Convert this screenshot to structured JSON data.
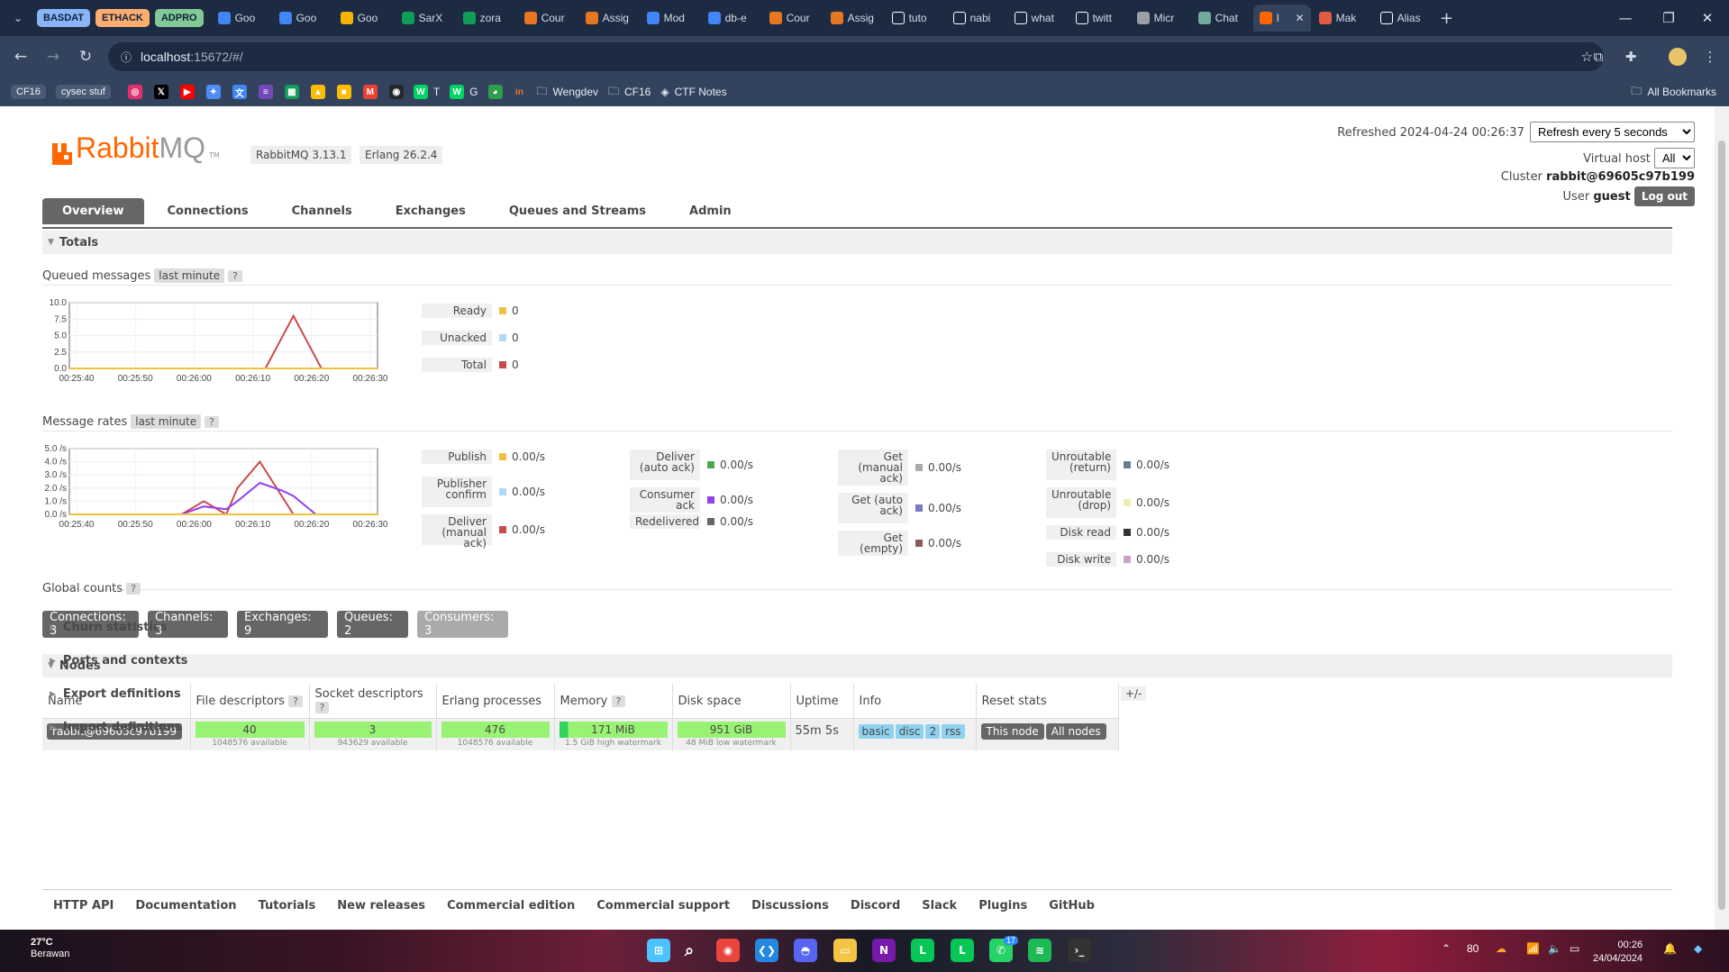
{
  "browser": {
    "tab_groups": [
      {
        "label": "BASDAT",
        "color": "#8ab4f8"
      },
      {
        "label": "ETHACK",
        "color": "#fcad70"
      },
      {
        "label": "ADPRO",
        "color": "#81c995"
      }
    ],
    "tabs": [
      {
        "label": "Goo",
        "icon": "google-icon",
        "color": "#4285f4"
      },
      {
        "label": "Goo",
        "icon": "google-docs-icon",
        "color": "#4285f4"
      },
      {
        "label": "Goo",
        "icon": "google-slides-icon",
        "color": "#f4b400"
      },
      {
        "label": "SarX",
        "icon": "sheets-icon",
        "color": "#0f9d58"
      },
      {
        "label": "zora",
        "icon": "sheets-icon",
        "color": "#0f9d58"
      },
      {
        "label": "Cour",
        "icon": "coursera-icon",
        "color": "#e87722"
      },
      {
        "label": "Assig",
        "icon": "coursera-icon",
        "color": "#e87722"
      },
      {
        "label": "Mod",
        "icon": "docs-icon",
        "color": "#4285f4"
      },
      {
        "label": "db-e",
        "icon": "loading-icon",
        "color": "#4285f4"
      },
      {
        "label": "Cour",
        "icon": "coursera-icon",
        "color": "#e87722"
      },
      {
        "label": "Assig",
        "icon": "coursera-icon",
        "color": "#e87722"
      },
      {
        "label": "tuto",
        "icon": "github-icon",
        "color": "#ffffff"
      },
      {
        "label": "nabi",
        "icon": "github-icon",
        "color": "#ffffff"
      },
      {
        "label": "what",
        "icon": "google-icon",
        "color": "#ffffff"
      },
      {
        "label": "twitt",
        "icon": "x-icon",
        "color": "#ffffff"
      },
      {
        "label": "Micr",
        "icon": "globe-icon",
        "color": "#9aa0a6"
      },
      {
        "label": "Chat",
        "icon": "chatgpt-icon",
        "color": "#74aa9c"
      },
      {
        "label": "I",
        "icon": "rabbitmq-icon",
        "color": "#ff6600",
        "active": true
      },
      {
        "label": "Mak",
        "icon": "flame-icon",
        "color": "#e05d44"
      },
      {
        "label": "Alias",
        "icon": "dev-icon",
        "color": "#ffffff"
      }
    ],
    "url_host": "localhost",
    "url_rest": ":15672/#/",
    "bookmarks": {
      "chips": [
        "CF16",
        "cysec stuf"
      ],
      "icons": [
        {
          "name": "instagram-icon",
          "color": "#e1306c",
          "glyph": "◎"
        },
        {
          "name": "x-icon",
          "color": "#000000",
          "glyph": "𝕏"
        },
        {
          "name": "youtube-icon",
          "color": "#ff0000",
          "glyph": "▶"
        },
        {
          "name": "gemini-icon",
          "color": "#4e8df5",
          "glyph": "✦"
        },
        {
          "name": "translate-icon",
          "color": "#4285f4",
          "glyph": "文"
        },
        {
          "name": "forms-icon",
          "color": "#7248b9",
          "glyph": "≡"
        },
        {
          "name": "sheets-icon",
          "color": "#0f9d58",
          "glyph": "▦"
        },
        {
          "name": "drive-icon",
          "color": "#fbbc04",
          "glyph": "▲"
        },
        {
          "name": "keep-icon",
          "color": "#fbbc04",
          "glyph": "■"
        },
        {
          "name": "gmail-icon",
          "color": "#ea4335",
          "glyph": "M"
        },
        {
          "name": "github-icon",
          "color": "#24292e",
          "glyph": "◉"
        }
      ],
      "links": [
        {
          "label": "T",
          "icon": "webtoon-icon"
        },
        {
          "label": "G",
          "icon": "webtoon-icon"
        }
      ],
      "folders": [
        "Wengdev",
        "CF16"
      ],
      "ctf": "CTF Notes",
      "all": "All Bookmarks"
    }
  },
  "header": {
    "logo_text_a": "Rabbit",
    "logo_text_b": "MQ",
    "logo_tm": "TM",
    "rabbit_version": "RabbitMQ 3.13.1",
    "erlang_version": "Erlang 26.2.4",
    "refreshed_label": "Refreshed",
    "refreshed_value": "2024-04-24 00:26:37",
    "refresh_option": "Refresh every 5 seconds",
    "vhost_label": "Virtual host",
    "vhost_value": "All",
    "cluster_label": "Cluster",
    "cluster_value": "rabbit@69605c97b199",
    "user_label": "User",
    "user_value": "guest",
    "logout": "Log out"
  },
  "nav": {
    "tabs": [
      "Overview",
      "Connections",
      "Channels",
      "Exchanges",
      "Queues and Streams",
      "Admin"
    ],
    "active": "Overview"
  },
  "totals": {
    "title": "Totals",
    "queued_label": "Queued messages",
    "queued_range": "last minute",
    "rates_label": "Message rates",
    "rates_range": "last minute",
    "help": "?"
  },
  "queued_legend": [
    {
      "name": "Ready",
      "value": "0",
      "color": "#edc240"
    },
    {
      "name": "Unacked",
      "value": "0",
      "color": "#afd8f8"
    },
    {
      "name": "Total",
      "value": "0",
      "color": "#cb4b4b"
    }
  ],
  "rates_legend": [
    [
      {
        "name": "Publish",
        "value": "0.00/s",
        "color": "#edc240"
      },
      {
        "name": "Publisher confirm",
        "value": "0.00/s",
        "color": "#afd8f8"
      },
      {
        "name": "Deliver (manual ack)",
        "value": "0.00/s",
        "color": "#cb4b4b"
      }
    ],
    [
      {
        "name": "Deliver (auto ack)",
        "value": "0.00/s",
        "color": "#4da74d"
      },
      {
        "name": "Consumer ack",
        "value": "0.00/s",
        "color": "#9440ed"
      },
      {
        "name": "Redelivered",
        "value": "0.00/s",
        "color": "#666666"
      }
    ],
    [
      {
        "name": "Get (manual ack)",
        "value": "0.00/s",
        "color": "#aaaaaa"
      },
      {
        "name": "Get (auto ack)",
        "value": "0.00/s",
        "color": "#7c79c3"
      },
      {
        "name": "Get (empty)",
        "value": "0.00/s",
        "color": "#8d5959"
      }
    ],
    [
      {
        "name": "Unroutable (return)",
        "value": "0.00/s",
        "color": "#697b8f"
      },
      {
        "name": "Unroutable (drop)",
        "value": "0.00/s",
        "color": "#eeeeaa"
      },
      {
        "name": "Disk read",
        "value": "0.00/s",
        "color": "#333333"
      },
      {
        "name": "Disk write",
        "value": "0.00/s",
        "color": "#c9a2c6"
      }
    ]
  ],
  "chart_data": [
    {
      "type": "line",
      "title": "",
      "x": [
        "00:25:40",
        "00:25:50",
        "00:26:00",
        "00:26:10",
        "00:26:20",
        "00:26:30"
      ],
      "x_values": [
        0,
        10,
        20,
        30,
        40,
        50,
        55
      ],
      "ylim": [
        0,
        10
      ],
      "yticks": [
        "10.0",
        "7.5",
        "5.0",
        "2.5",
        "0.0"
      ],
      "series": [
        {
          "name": "Total",
          "color": "#cb4b4b",
          "points": [
            [
              0,
              0
            ],
            [
              35,
              0
            ],
            [
              40,
              8
            ],
            [
              45,
              0
            ],
            [
              55,
              0
            ]
          ]
        },
        {
          "name": "Ready",
          "color": "#edc240",
          "points": [
            [
              0,
              0
            ],
            [
              55,
              0
            ]
          ]
        }
      ]
    },
    {
      "type": "line",
      "title": "",
      "x": [
        "00:25:40",
        "00:25:50",
        "00:26:00",
        "00:26:10",
        "00:26:20",
        "00:26:30"
      ],
      "ylim": [
        0,
        5
      ],
      "yticks": [
        "5.0 /s",
        "4.0 /s",
        "3.0 /s",
        "2.0 /s",
        "1.0 /s",
        "0.0 /s"
      ],
      "series": [
        {
          "name": "Deliver (manual ack)",
          "color": "#cb4b4b",
          "points": [
            [
              0,
              0
            ],
            [
              20,
              0
            ],
            [
              24,
              1
            ],
            [
              28,
              0
            ],
            [
              30,
              2
            ],
            [
              34,
              4
            ],
            [
              40,
              0
            ],
            [
              55,
              0
            ]
          ]
        },
        {
          "name": "Consumer ack",
          "color": "#9440ed",
          "points": [
            [
              0,
              0
            ],
            [
              20,
              0
            ],
            [
              24,
              0.6
            ],
            [
              28,
              0.4
            ],
            [
              30,
              1
            ],
            [
              34,
              2.4
            ],
            [
              38,
              1.8
            ],
            [
              40,
              1.4
            ],
            [
              44,
              0
            ],
            [
              55,
              0
            ]
          ]
        },
        {
          "name": "Publish",
          "color": "#edc240",
          "points": [
            [
              0,
              0
            ],
            [
              55,
              0
            ]
          ]
        }
      ]
    }
  ],
  "global_counts": {
    "title": "Global counts",
    "items": [
      {
        "label": "Connections: 3"
      },
      {
        "label": "Channels: 3"
      },
      {
        "label": "Exchanges: 9"
      },
      {
        "label": "Queues: 2"
      },
      {
        "label": "Consumers: 3",
        "dim": true
      }
    ]
  },
  "nodes": {
    "title": "Nodes",
    "headers": [
      "Name",
      "File descriptors",
      "Socket descriptors",
      "Erlang processes",
      "Memory",
      "Disk space",
      "Uptime",
      "Info",
      "Reset stats"
    ],
    "row": {
      "name": "rabbit@69605c97b199",
      "fd": "40",
      "fd_sub": "1048576 available",
      "sd": "3",
      "sd_sub": "943629 available",
      "ep": "476",
      "ep_sub": "1048576 available",
      "mem": "171 MiB",
      "mem_sub": "1.5 GiB high watermark",
      "disk": "951 GiB",
      "disk_sub": "48 MiB low watermark",
      "uptime": "55m 5s",
      "info": [
        "basic",
        "disc",
        "2",
        "rss"
      ],
      "reset": [
        "This node",
        "All nodes"
      ]
    },
    "plusminus": "+/-"
  },
  "sections": [
    "Churn statistics",
    "Ports and contexts",
    "Export definitions",
    "Import definitions"
  ],
  "footer": [
    "HTTP API",
    "Documentation",
    "Tutorials",
    "New releases",
    "Commercial edition",
    "Commercial support",
    "Discussions",
    "Discord",
    "Slack",
    "Plugins",
    "GitHub"
  ],
  "taskbar": {
    "temp": "27°C",
    "weather": "Berawan",
    "battery": "80",
    "time": "00:26",
    "date": "24/04/2024",
    "badge_whatsapp": "17"
  }
}
